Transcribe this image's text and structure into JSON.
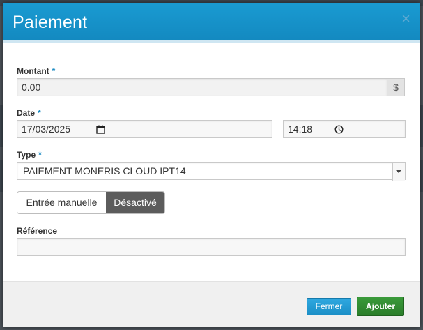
{
  "modal": {
    "title": "Paiement",
    "close_symbol": "×",
    "required_marker": "*"
  },
  "form": {
    "amount": {
      "label": "Montant",
      "value": "0.00",
      "currency": "$"
    },
    "date": {
      "label": "Date",
      "date_value": "17/03/2025",
      "time_value": "14:18"
    },
    "type": {
      "label": "Type",
      "selected": "PAIEMENT MONERIS CLOUD IPT14"
    },
    "manual_entry": {
      "option_label": "Entrée manuelle",
      "state_label": "Désactivé"
    },
    "reference": {
      "label": "Référence",
      "value": ""
    }
  },
  "footer": {
    "close_label": "Fermer",
    "add_label": "Ajouter"
  },
  "colors": {
    "header": "#1a9bd2",
    "required": "#1a8ac2",
    "close_button": "#2fa8e0",
    "add_button": "#3a9a3a",
    "toggle_active": "#5c5c5c"
  },
  "icons": {
    "calendar": "calendar-icon",
    "clock": "clock-icon",
    "close": "close-icon",
    "dropdown": "chevron-down-icon"
  }
}
